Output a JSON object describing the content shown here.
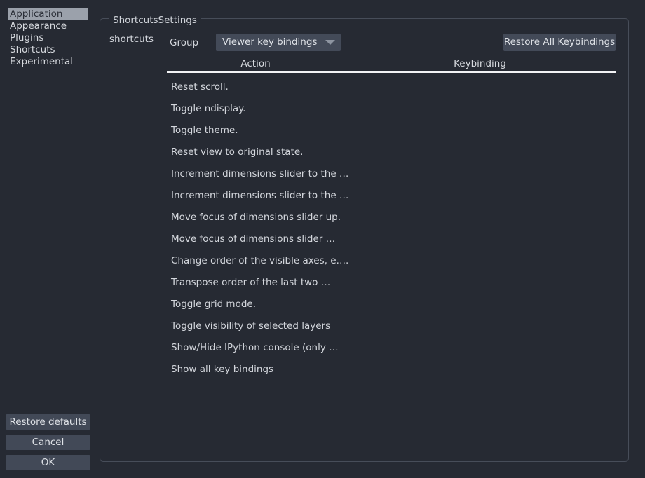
{
  "sidebar": {
    "items": [
      {
        "label": "Application",
        "selected": true
      },
      {
        "label": "Appearance",
        "selected": false
      },
      {
        "label": "Plugins",
        "selected": false
      },
      {
        "label": "Shortcuts",
        "selected": false
      },
      {
        "label": "Experimental",
        "selected": false
      }
    ],
    "buttons": {
      "restore_defaults": "Restore defaults",
      "cancel": "Cancel",
      "ok": "OK"
    }
  },
  "groupbox": {
    "title": "ShortcutsSettings",
    "field_label": "shortcuts"
  },
  "group_row": {
    "label": "Group",
    "combo_value": "Viewer key bindings",
    "combo_icon": "chevron-down-icon",
    "restore_all_label": "Restore All Keybindings"
  },
  "table": {
    "columns": [
      "Action",
      "Keybinding"
    ],
    "rows": [
      {
        "action": "Reset scroll.",
        "keybinding": ""
      },
      {
        "action": "Toggle ndisplay.",
        "keybinding": ""
      },
      {
        "action": "Toggle theme.",
        "keybinding": ""
      },
      {
        "action": "Reset view to original state.",
        "keybinding": ""
      },
      {
        "action": "Increment dimensions slider to the …",
        "keybinding": ""
      },
      {
        "action": "Increment dimensions slider to the …",
        "keybinding": ""
      },
      {
        "action": "Move focus of dimensions slider up.",
        "keybinding": ""
      },
      {
        "action": "Move focus of dimensions slider …",
        "keybinding": ""
      },
      {
        "action": "Change order of the visible axes, e….",
        "keybinding": ""
      },
      {
        "action": "Transpose order of the last two …",
        "keybinding": ""
      },
      {
        "action": "Toggle grid mode.",
        "keybinding": ""
      },
      {
        "action": "Toggle visibility of selected layers",
        "keybinding": ""
      },
      {
        "action": "Show/Hide IPython console (only …",
        "keybinding": ""
      },
      {
        "action": "Show all key bindings",
        "keybinding": ""
      }
    ]
  },
  "colors": {
    "background": "#262a33",
    "button": "#434a58",
    "selection": "#9ba1ab",
    "text": "#d3d6dc",
    "border": "#474d59",
    "header_rule": "#f2f3f5"
  }
}
